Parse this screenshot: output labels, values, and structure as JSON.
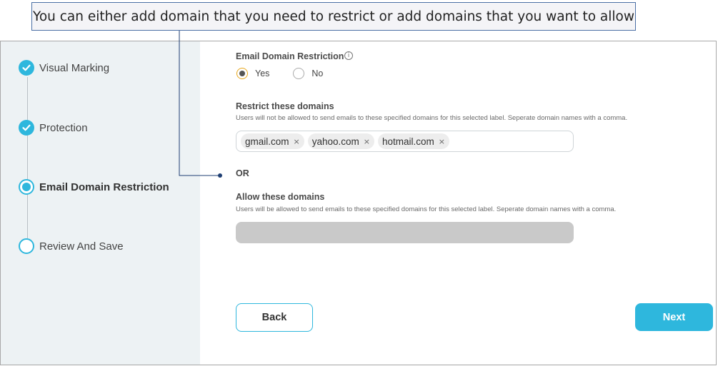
{
  "callout": {
    "text": "You can either add domain that you need to restrict or add domains that you want to allow"
  },
  "steps": [
    {
      "label": "Visual Marking",
      "state": "done"
    },
    {
      "label": "Protection",
      "state": "done"
    },
    {
      "label": "Email Domain Restriction",
      "state": "current"
    },
    {
      "label": "Review And Save",
      "state": "todo"
    }
  ],
  "restriction": {
    "title": "Email Domain Restriction",
    "info_icon": "info-icon",
    "options": [
      {
        "label": "Yes",
        "checked": true
      },
      {
        "label": "No",
        "checked": false
      }
    ]
  },
  "restrict": {
    "title": "Restrict these domains",
    "helper": "Users will not be allowed to send emails to these specified domains for this selected label. Seperate domain names with a comma.",
    "chips": [
      "gmail.com",
      "yahoo.com",
      "hotmail.com"
    ],
    "remove_glyph": "×"
  },
  "or_label": "OR",
  "allow": {
    "title": "Allow these domains",
    "helper": "Users will be allowed to send emails to these specified domains for this selected label. Seperate domain names with a comma.",
    "value": ""
  },
  "buttons": {
    "back": "Back",
    "next": "Next"
  },
  "colors": {
    "accent": "#2eb7dd",
    "sidebar_bg": "#edf2f4",
    "radio_ring": "#e7a61a",
    "disabled_input": "#c9c9c9"
  }
}
